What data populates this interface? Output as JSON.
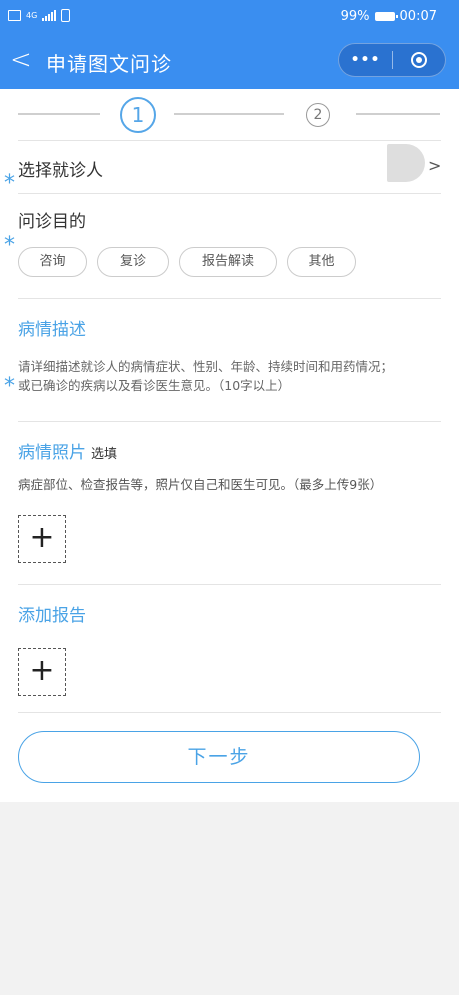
{
  "status_bar": {
    "left_badge": "HD",
    "network": "4G",
    "battery_percent": "99%",
    "time": "00:07"
  },
  "nav": {
    "back": "<",
    "title": "申请图文问诊",
    "more": "•••"
  },
  "steps": {
    "current": "1",
    "next": "2"
  },
  "form": {
    "patient_label": "选择就诊人",
    "purpose_label": "问诊目的",
    "purpose_options": [
      "咨询",
      "复诊",
      "报告解读",
      "其他"
    ],
    "description_label": "病情描述",
    "description_placeholder_line1": "请详细描述就诊人的病情症状、性别、年龄、持续时间和用药情况；",
    "description_placeholder_line2": "或已确诊的疾病以及看诊医生意见。（10字以上）",
    "photos_label": "病情照片",
    "photos_optional": "选填",
    "photos_hint": "病症部位、检查报告等，照片仅自己和医生可见。（最多上传9张）",
    "report_label": "添加报告",
    "required_mark": "*",
    "add": "+",
    "chevron": ">"
  },
  "next_button": "下一步",
  "colors": {
    "brand_blue": "#3a8ef0",
    "accent_blue": "#4aa3e6"
  }
}
